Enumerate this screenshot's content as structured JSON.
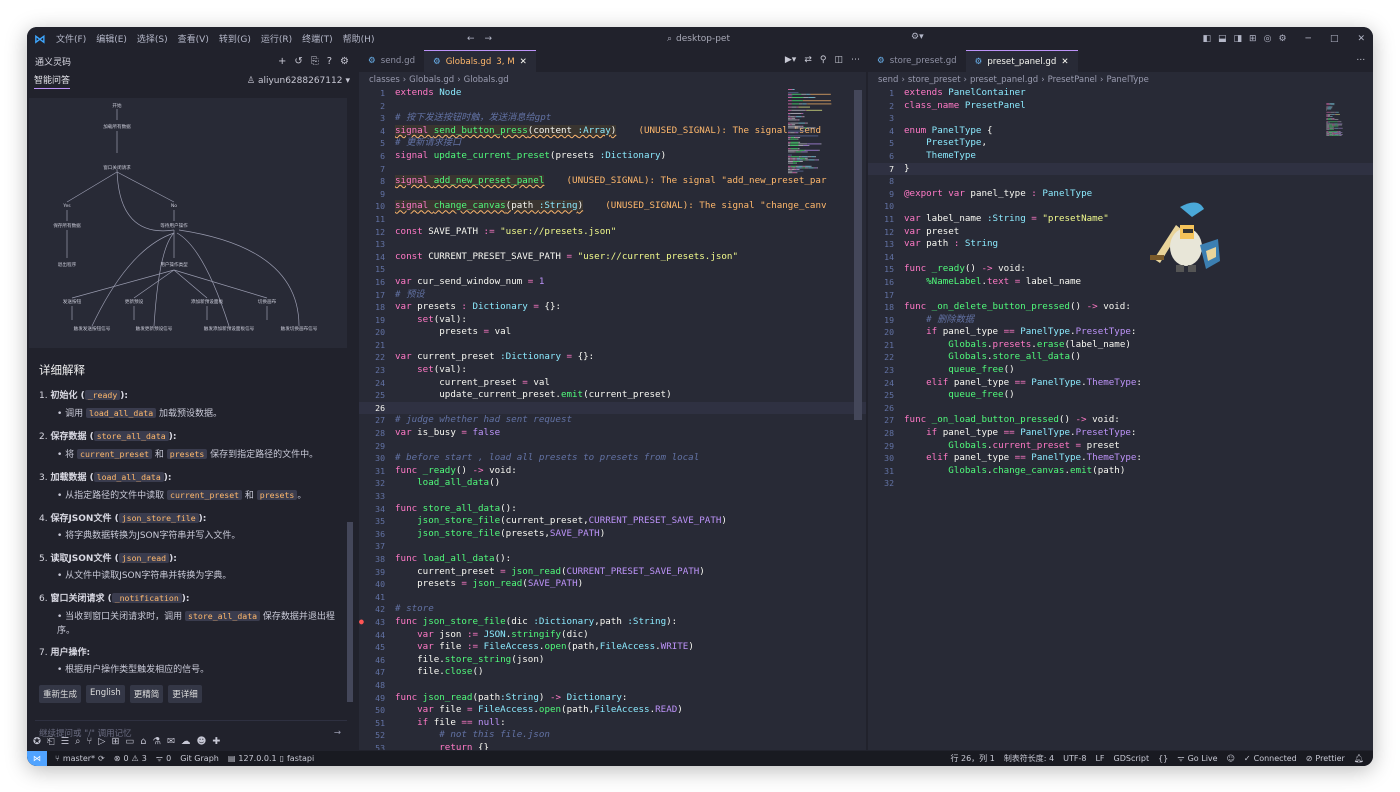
{
  "titlebar": {
    "menus": [
      "文件(F)",
      "编辑(E)",
      "选择(S)",
      "查看(V)",
      "转到(G)",
      "运行(R)",
      "终端(T)",
      "帮助(H)"
    ],
    "command_center": "desktop-pet"
  },
  "sidebar": {
    "title": "通义灵码",
    "tab": "智能问答",
    "user": "aliyun6288267112",
    "section_title": "详细解释",
    "items": [
      {
        "n": "1.",
        "head": "初始化 (",
        "code": "_ready",
        "tail": "):",
        "sub": {
          "pre": "调用 ",
          "code": "load_all_data",
          "post": " 加载预设数据。"
        }
      },
      {
        "n": "2.",
        "head": "保存数据 (",
        "code": "store_all_data",
        "tail": "):",
        "sub": {
          "pre": "将 ",
          "code": "current_preset",
          "mid": " 和 ",
          "code2": "presets",
          "post": " 保存到指定路径的文件中。"
        }
      },
      {
        "n": "3.",
        "head": "加载数据 (",
        "code": "load_all_data",
        "tail": "):",
        "sub": {
          "pre": "从指定路径的文件中读取 ",
          "code": "current_preset",
          "mid": " 和 ",
          "code2": "presets",
          "post": "。"
        }
      },
      {
        "n": "4.",
        "head": "保存JSON文件 (",
        "code": "json_store_file",
        "tail": "):",
        "sub": {
          "pre": "将字典数据转换为JSON字符串并写入文件。"
        }
      },
      {
        "n": "5.",
        "head": "读取JSON文件 (",
        "code": "json_read",
        "tail": "):",
        "sub": {
          "pre": "从文件中读取JSON字符串并转换为字典。"
        }
      },
      {
        "n": "6.",
        "head": "窗口关闭请求 (",
        "code": "_notification",
        "tail": "):",
        "sub": {
          "pre": "当收到窗口关闭请求时，调用 ",
          "code": "store_all_data",
          "post": " 保存数据并退出程序。"
        }
      },
      {
        "n": "7.",
        "head": "用户操作:",
        "code": "",
        "tail": "",
        "sub": {
          "pre": "根据用户操作类型触发相应的信号。"
        }
      }
    ],
    "chips": [
      "重新生成",
      "English",
      "更精简",
      "更详细"
    ],
    "input_placeholder": "继续提问或 \"/\" 调用记忆",
    "diagram": {
      "nodes": [
        "开始",
        "加载所有数据",
        "窗口关闭请求",
        "Yes",
        "No",
        "保存所有数据",
        "等待用户操作",
        "退出程序",
        "用户操作类型",
        "发送按钮",
        "更新预设",
        "添加新预设面板",
        "切换画布",
        "触发发送按钮信号",
        "触发更新预设信号",
        "触发添加新预设面板信号",
        "触发切换画布信号"
      ]
    }
  },
  "editor1": {
    "tabs": [
      {
        "label": "send.gd",
        "active": false
      },
      {
        "label": "Globals.gd",
        "badge": "3, M",
        "active": true
      }
    ],
    "breadcrumb": [
      "classes",
      "Globals.gd",
      "Globals.gd"
    ]
  },
  "editor2": {
    "tabs": [
      {
        "label": "store_preset.gd",
        "active": false
      },
      {
        "label": "preset_panel.gd",
        "active": true
      }
    ],
    "breadcrumb": [
      "send",
      "store_preset",
      "preset_panel.gd",
      "PresetPanel",
      "PanelType"
    ]
  },
  "status": {
    "branch": "master*",
    "errors": "0",
    "warnings": "3",
    "info": "0",
    "git_graph": "Git Graph",
    "server": "127.0.0.1",
    "api": "fastapi",
    "position": "行 26，列 1",
    "indent": "制表符长度: 4",
    "encoding": "UTF-8",
    "eol": "LF",
    "language": "GDScript",
    "golive": "Go Live",
    "connected": "Connected",
    "prettier": "Prettier"
  },
  "colors": {
    "bg": "#282a36",
    "sidebar": "#21222c",
    "accent": "#bd93f9",
    "keyword": "#ff79c6",
    "function": "#50fa7b",
    "type": "#8be9fd",
    "string": "#f1fa8c",
    "comment": "#6272a4",
    "warning": "#ffb86c"
  }
}
